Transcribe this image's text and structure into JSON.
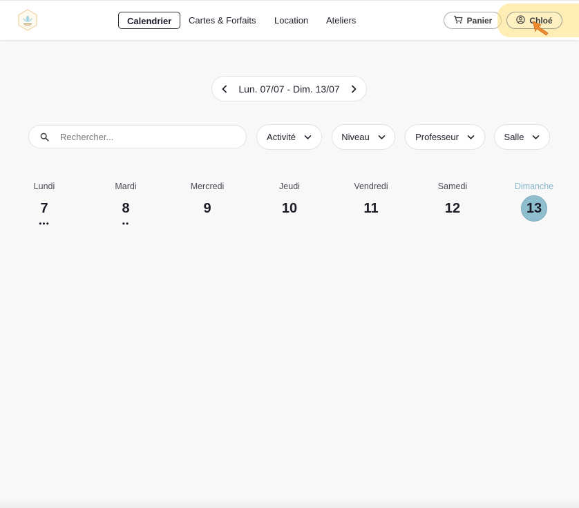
{
  "header": {
    "nav": [
      {
        "label": "Calendrier",
        "active": true
      },
      {
        "label": "Cartes & Forfaits",
        "active": false
      },
      {
        "label": "Location",
        "active": false
      },
      {
        "label": "Ateliers",
        "active": false
      }
    ],
    "cart_label": "Panier",
    "user_label": "Chloé",
    "logo_icon": "lotus-logo-icon",
    "cart_icon": "cart-icon",
    "user_icon": "user-circle-icon"
  },
  "week": {
    "label": "Lun. 07/07 - Dim. 13/07",
    "prev_icon": "chevron-left-icon",
    "next_icon": "chevron-right-icon"
  },
  "search": {
    "placeholder": "Rechercher...",
    "value": "",
    "icon": "search-icon"
  },
  "filters": [
    {
      "label": "Activité"
    },
    {
      "label": "Niveau"
    },
    {
      "label": "Professeur"
    },
    {
      "label": "Salle"
    }
  ],
  "days": [
    {
      "name": "Lundi",
      "number": "7",
      "dots": "•••",
      "today": false
    },
    {
      "name": "Mardi",
      "number": "8",
      "dots": "••",
      "today": false
    },
    {
      "name": "Mercredi",
      "number": "9",
      "dots": "",
      "today": false
    },
    {
      "name": "Jeudi",
      "number": "10",
      "dots": "",
      "today": false
    },
    {
      "name": "Vendredi",
      "number": "11",
      "dots": "",
      "today": false
    },
    {
      "name": "Samedi",
      "number": "12",
      "dots": "",
      "today": false
    },
    {
      "name": "Dimanche",
      "number": "13",
      "dots": "",
      "today": true
    }
  ],
  "colors": {
    "today_accent": "#8fbfcf",
    "highlight": "#fde078",
    "cursor": "#f08a2c",
    "background": "#f8f8f8"
  }
}
